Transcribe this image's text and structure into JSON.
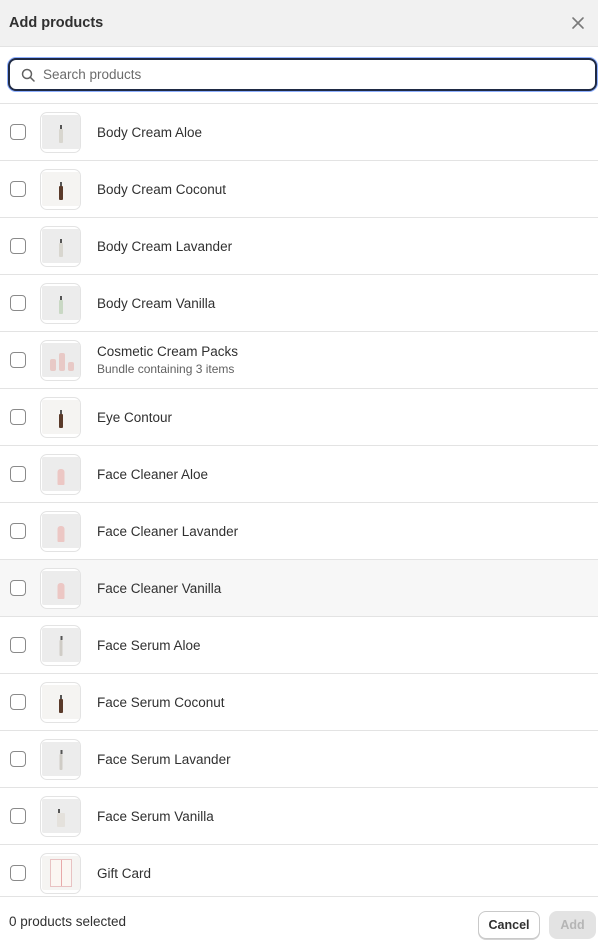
{
  "header": {
    "title": "Add products",
    "close_icon": "close-icon"
  },
  "search": {
    "placeholder": "Search products",
    "value": "",
    "icon": "search-icon"
  },
  "products": [
    {
      "name": "Body Cream Aloe",
      "subtitle": "",
      "thumb": "bottle"
    },
    {
      "name": "Body Cream Coconut",
      "subtitle": "",
      "thumb": "bottle-dark"
    },
    {
      "name": "Body Cream Lavander",
      "subtitle": "",
      "thumb": "bottle"
    },
    {
      "name": "Body Cream Vanilla",
      "subtitle": "",
      "thumb": "bottle-green"
    },
    {
      "name": "Cosmetic Cream Packs",
      "subtitle": "Bundle containing 3 items",
      "thumb": "packs"
    },
    {
      "name": "Eye Contour",
      "subtitle": "",
      "thumb": "bottle-dark"
    },
    {
      "name": "Face Cleaner Aloe",
      "subtitle": "",
      "thumb": "tube"
    },
    {
      "name": "Face Cleaner Lavander",
      "subtitle": "",
      "thumb": "tube"
    },
    {
      "name": "Face Cleaner Vanilla",
      "subtitle": "",
      "thumb": "tube"
    },
    {
      "name": "Face Serum Aloe",
      "subtitle": "",
      "thumb": "serum"
    },
    {
      "name": "Face Serum Coconut",
      "subtitle": "",
      "thumb": "bottle-dark"
    },
    {
      "name": "Face Serum Lavander",
      "subtitle": "",
      "thumb": "serum"
    },
    {
      "name": "Face Serum Vanilla",
      "subtitle": "",
      "thumb": "wide"
    },
    {
      "name": "Gift Card",
      "subtitle": "",
      "thumb": "gift"
    }
  ],
  "footer": {
    "selected_text": "0 products selected",
    "cancel_label": "Cancel",
    "add_label": "Add"
  },
  "colors": {
    "header_bg": "#f1f1f1",
    "border": "#e3e3e3",
    "focus_ring": "#1f2a44",
    "disabled_bg": "#e3e3e3"
  }
}
